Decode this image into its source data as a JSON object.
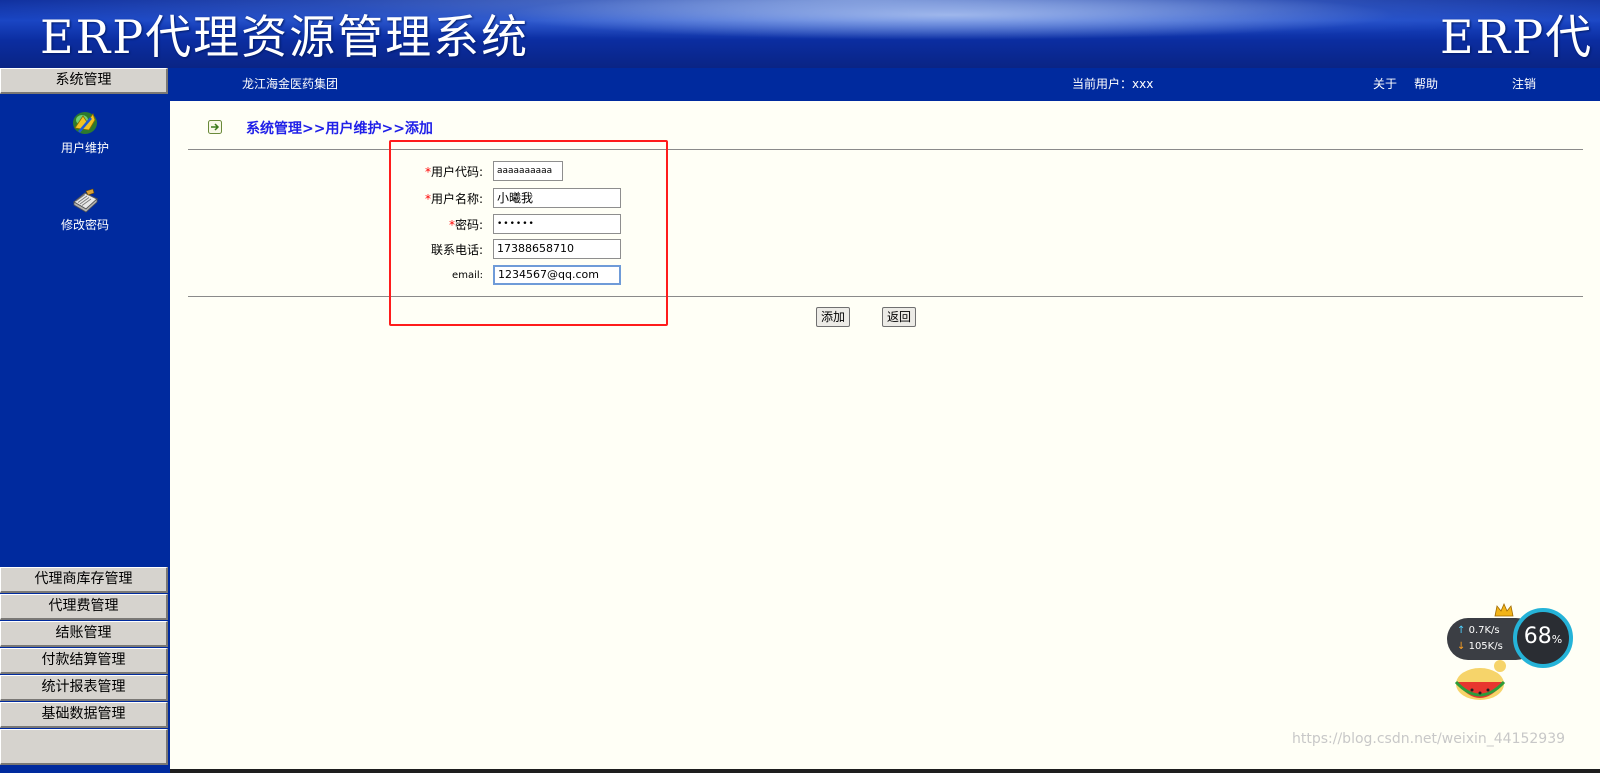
{
  "banner": {
    "title": "ERP代理资源管理系统",
    "title_repeat": "ERP代"
  },
  "infobar": {
    "company": "龙江海金医药集团",
    "current_user_label": "当前用户：xxx",
    "about": "关于",
    "help": "帮助",
    "logout": "注销"
  },
  "sidebar": {
    "top_menu": "系统管理",
    "tools": [
      {
        "label": "用户维护",
        "icon": "users-icon"
      },
      {
        "label": "修改密码",
        "icon": "notebook-icon"
      }
    ],
    "bottom_menus": [
      "代理商库存管理",
      "代理费管理",
      "结账管理",
      "付款结算管理",
      "统计报表管理",
      "基础数据管理"
    ]
  },
  "breadcrumb": "系统管理>>用户维护>>添加",
  "form": {
    "user_code": {
      "label": "用户代码:",
      "value": "aaaaaaaaaa"
    },
    "user_name": {
      "label": "用户名称:",
      "value": "小曦我"
    },
    "password": {
      "label": "密码:",
      "value": "••••••"
    },
    "phone": {
      "label": "联系电话:",
      "value": "17388658710"
    },
    "email": {
      "label": "email:",
      "value": "1234567@qq.com"
    },
    "required_mark": "*"
  },
  "buttons": {
    "add": "添加",
    "back": "返回"
  },
  "netwidget": {
    "upload": "0.7K/s",
    "download": "105K/s",
    "percent": "68",
    "percent_unit": "%"
  },
  "watermark": "https://blog.csdn.net/weixin_44152939",
  "colors": {
    "nav_blue": "#002a9e",
    "breadcrumb_blue": "#2020e8",
    "highlight_red": "#ff1c1c",
    "required_red": "#ff0000"
  }
}
